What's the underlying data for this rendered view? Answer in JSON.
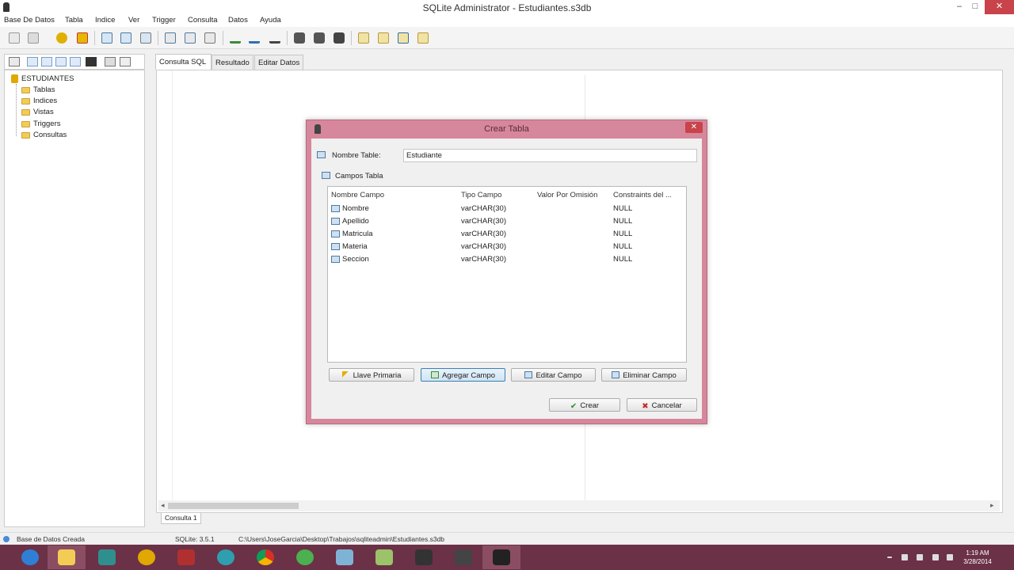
{
  "window": {
    "title": "SQLite Administrator - Estudiantes.s3db",
    "min": "–",
    "max": "□",
    "close": "✕"
  },
  "menu": [
    "Base De Datos",
    "Tabla",
    "Indice",
    "Ver",
    "Trigger",
    "Consulta",
    "Datos",
    "Ayuda"
  ],
  "tree": {
    "root": "ESTUDIANTES",
    "children": [
      "Tablas",
      "Indices",
      "Vistas",
      "Triggers",
      "Consultas"
    ]
  },
  "tabs": [
    "Consulta SQL",
    "Resultado",
    "Editar Datos"
  ],
  "editor": {
    "subtab": "Consulta 1"
  },
  "status": {
    "message": "Base de Datos Creada",
    "version": "SQLite: 3.5.1",
    "path": "C:\\Users\\JoseGarcia\\Desktop\\Trabajos\\sqliteadmin\\Estudiantes.s3db"
  },
  "dialog": {
    "title": "Crear Tabla",
    "close": "✕",
    "name_label": "Nombre Table:",
    "name_value": "Estudiante",
    "fields_label": "Campos Tabla",
    "columns": [
      "Nombre Campo",
      "Tipo Campo",
      "Valor Por Omisión",
      "Constraints del ..."
    ],
    "rows": [
      {
        "name": "Nombre",
        "type": "varCHAR(30)",
        "default": "",
        "constraint": "NULL"
      },
      {
        "name": "Apellido",
        "type": "varCHAR(30)",
        "default": "",
        "constraint": "NULL"
      },
      {
        "name": "Matricula",
        "type": "varCHAR(30)",
        "default": "",
        "constraint": "NULL"
      },
      {
        "name": "Materia",
        "type": "varCHAR(30)",
        "default": "",
        "constraint": "NULL"
      },
      {
        "name": "Seccion",
        "type": "varCHAR(30)",
        "default": "",
        "constraint": "NULL"
      }
    ],
    "buttons": {
      "primary_key": "Llave Primaria",
      "add_field": "Agregar Campo",
      "edit_field": "Editar Campo",
      "delete_field": "Eliminar Campo",
      "create": "Crear",
      "cancel": "Cancelar"
    }
  },
  "taskbar": {
    "time": "1:19 AM",
    "date": "3/28/2014"
  },
  "colors": {
    "dialog_frame": "#d7879c",
    "taskbar": "#6b3146",
    "close_button": "#c8434a"
  }
}
